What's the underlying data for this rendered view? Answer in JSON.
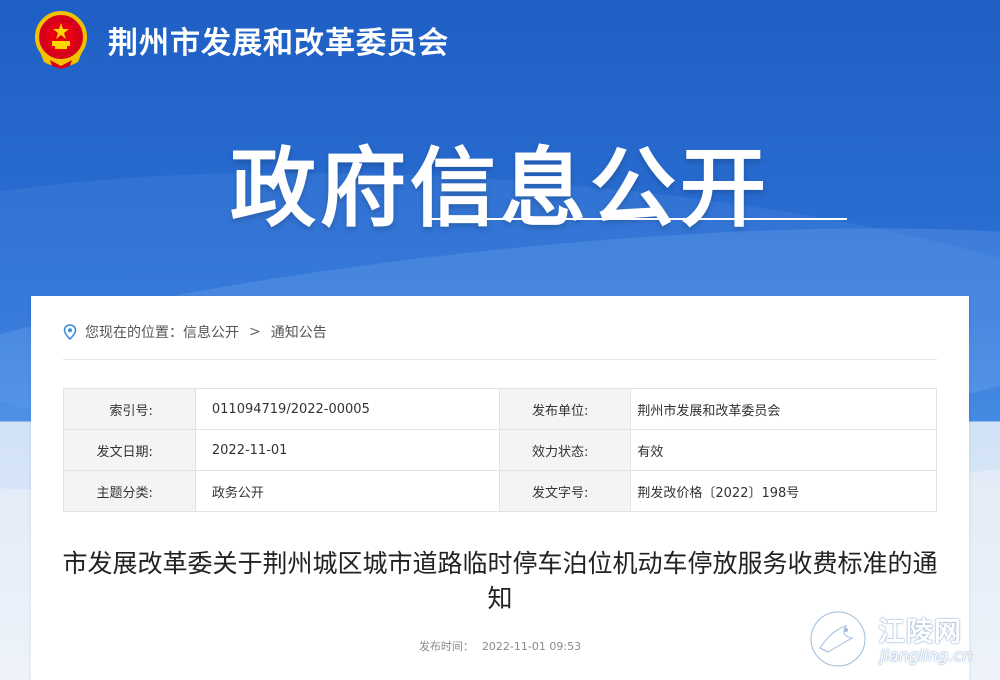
{
  "header": {
    "site_name": "荆州市发展和改革委员会",
    "emblem_icon": "national-emblem-icon"
  },
  "hero": {
    "title": "政府信息公开"
  },
  "breadcrumb": {
    "icon": "location-pin-icon",
    "prefix": "您现在的位置：",
    "items": [
      "信息公开",
      "通知公告"
    ],
    "separator": ">"
  },
  "meta": {
    "rows": [
      {
        "k1": "索引号:",
        "v1": "011094719/2022-00005",
        "k2": "发布单位:",
        "v2": "荆州市发展和改革委员会"
      },
      {
        "k1": "发文日期:",
        "v1": "2022-11-01",
        "k2": "效力状态:",
        "v2": "有效"
      },
      {
        "k1": "主题分类:",
        "v1": "政务公开",
        "k2": "发文字号:",
        "v2": "荆发改价格〔2022〕198号"
      }
    ]
  },
  "article": {
    "title": "市发展改革委关于荆州城区城市道路临时停车泊位机动车停放服务收费标准的通知",
    "publish_label": "发布时间：",
    "publish_time": "2022-11-01 09:53"
  },
  "watermark": {
    "name": "江陵网",
    "domain": "jiangling.cn",
    "icon": "jiangling-logo-icon"
  },
  "colors": {
    "header_blue": "#1f5fc4",
    "hero_blue": "#3e86e2",
    "label_bg": "#f3f4f6",
    "icon_blue": "#3b8de0"
  }
}
